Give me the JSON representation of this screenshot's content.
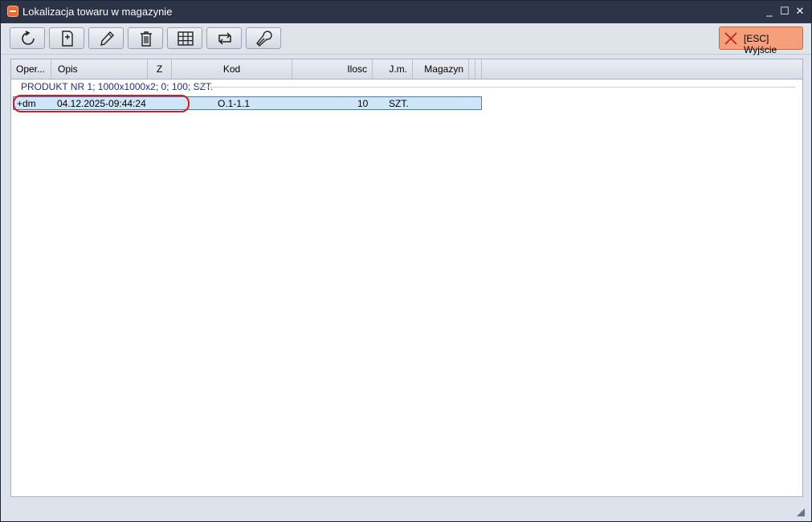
{
  "window": {
    "title": "Lokalizacja towaru w magazynie",
    "controls": {
      "minimize": "_",
      "maximize": "☐",
      "close": "✕"
    }
  },
  "toolbar": {
    "buttons": [
      {
        "icon": "refresh-icon"
      },
      {
        "icon": "new-document-icon"
      },
      {
        "icon": "edit-pencil-icon"
      },
      {
        "icon": "delete-trash-icon"
      },
      {
        "icon": "grid-table-icon"
      },
      {
        "icon": "swap-arrows-icon"
      },
      {
        "icon": "wrench-settings-icon"
      }
    ],
    "exit_label": "[ESC] Wyjście",
    "exit_color": "#f5a07b"
  },
  "grid": {
    "columns": [
      "Oper...",
      "Opis",
      "Z",
      "Kod",
      "Ilosc",
      "J.m.",
      "Magazyn"
    ],
    "group_label": "PRODUKT NR 1; 1000x1000x2; 0; 100; SZT.",
    "rows": [
      {
        "oper": "+dm",
        "opis": "04.12.2025-09:44:24",
        "z": "",
        "kod": "O.1-1.1",
        "ilosc": "10",
        "jm": "SZT.",
        "magazyn": ""
      }
    ]
  },
  "colors": {
    "titlebar": "#2d3447",
    "selection": "#cfe6f8",
    "group_text": "#1e2f83",
    "annotation": "#d71920"
  }
}
